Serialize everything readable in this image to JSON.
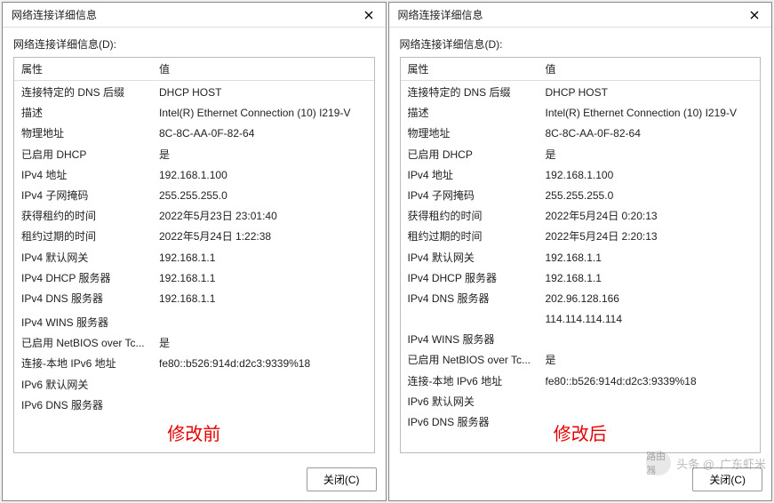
{
  "dialog_title": "网络连接详细信息",
  "subtitle": "网络连接详细信息(D):",
  "headers": {
    "property": "属性",
    "value": "值"
  },
  "close_button": "关闭(C)",
  "annotations": {
    "left": "修改前",
    "right": "修改后"
  },
  "watermark": {
    "prefix": "头条 @",
    "name": "广东虾米",
    "badge": "路由器"
  },
  "left": {
    "rows": [
      {
        "p": "连接特定的 DNS 后缀",
        "v": "DHCP HOST"
      },
      {
        "p": "描述",
        "v": "Intel(R) Ethernet Connection (10) I219-V"
      },
      {
        "p": "物理地址",
        "v": "8C-8C-AA-0F-82-64"
      },
      {
        "p": "已启用 DHCP",
        "v": "是"
      },
      {
        "p": "IPv4 地址",
        "v": "192.168.1.100"
      },
      {
        "p": "IPv4 子网掩码",
        "v": "255.255.255.0"
      },
      {
        "p": "获得租约的时间",
        "v": "2022年5月23日 23:01:40"
      },
      {
        "p": "租约过期的时间",
        "v": "2022年5月24日 1:22:38"
      },
      {
        "p": "IPv4 默认网关",
        "v": "192.168.1.1"
      },
      {
        "p": "IPv4 DHCP 服务器",
        "v": "192.168.1.1"
      },
      {
        "p": "IPv4 DNS 服务器",
        "v": "192.168.1.1"
      },
      {
        "p": "",
        "v": ""
      },
      {
        "p": "IPv4 WINS 服务器",
        "v": ""
      },
      {
        "p": "已启用 NetBIOS over Tc...",
        "v": "是"
      },
      {
        "p": "连接-本地 IPv6 地址",
        "v": "fe80::b526:914d:d2c3:9339%18"
      },
      {
        "p": "IPv6 默认网关",
        "v": ""
      },
      {
        "p": "IPv6 DNS 服务器",
        "v": ""
      }
    ]
  },
  "right": {
    "rows": [
      {
        "p": "连接特定的 DNS 后缀",
        "v": "DHCP HOST"
      },
      {
        "p": "描述",
        "v": "Intel(R) Ethernet Connection (10) I219-V"
      },
      {
        "p": "物理地址",
        "v": "8C-8C-AA-0F-82-64"
      },
      {
        "p": "已启用 DHCP",
        "v": "是"
      },
      {
        "p": "IPv4 地址",
        "v": "192.168.1.100"
      },
      {
        "p": "IPv4 子网掩码",
        "v": "255.255.255.0"
      },
      {
        "p": "获得租约的时间",
        "v": "2022年5月24日 0:20:13"
      },
      {
        "p": "租约过期的时间",
        "v": "2022年5月24日 2:20:13"
      },
      {
        "p": "IPv4 默认网关",
        "v": "192.168.1.1"
      },
      {
        "p": "IPv4 DHCP 服务器",
        "v": "192.168.1.1"
      },
      {
        "p": "IPv4 DNS 服务器",
        "v": "202.96.128.166"
      },
      {
        "p": "",
        "v": "114.114.114.114"
      },
      {
        "p": "IPv4 WINS 服务器",
        "v": ""
      },
      {
        "p": "已启用 NetBIOS over Tc...",
        "v": "是"
      },
      {
        "p": "连接-本地 IPv6 地址",
        "v": "fe80::b526:914d:d2c3:9339%18"
      },
      {
        "p": "IPv6 默认网关",
        "v": ""
      },
      {
        "p": "IPv6 DNS 服务器",
        "v": ""
      }
    ]
  }
}
